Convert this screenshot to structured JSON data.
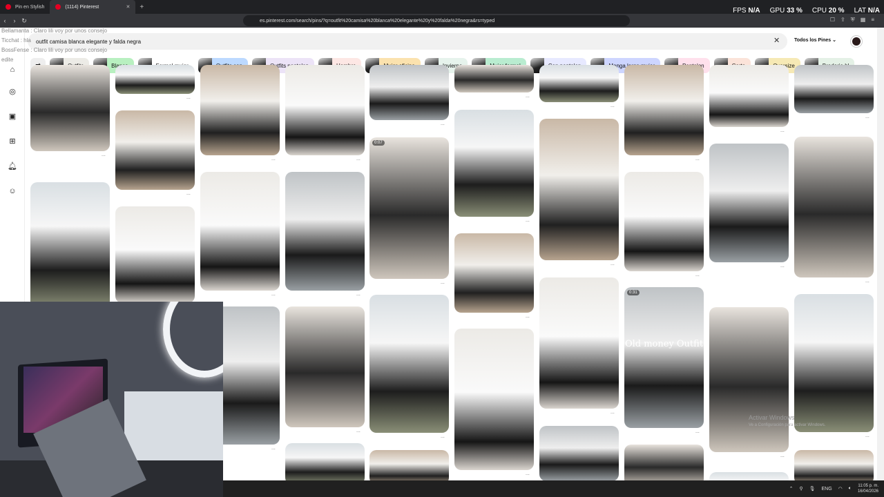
{
  "browser": {
    "tabs": [
      {
        "label": "Pin en Stylish",
        "active": false
      },
      {
        "label": "(1114) Pinterest",
        "active": true
      }
    ],
    "new_tab": "+",
    "url": "es.pinterest.com/search/pins/?q=outfit%20camisa%20blanca%20elegante%20y%20falda%20negra&rs=typed"
  },
  "hud": {
    "fps_label": "FPS",
    "fps_value": "N/A",
    "gpu_label": "GPU",
    "gpu_value": "33 %",
    "cpu_label": "CPU",
    "cpu_value": "20 %",
    "lat_label": "LAT",
    "lat_value": "N/A"
  },
  "chat": {
    "line1": "Bellamanta : Claro lili voy por unos consejo",
    "line2": "Ticchat : hla",
    "line3": "BossFense : Claro lili voy por unos consejo",
    "line4": "edite"
  },
  "search": {
    "query": "outfit camisa blanca elegante y falda negra",
    "filter_label": "Todos los Pines"
  },
  "chips": [
    {
      "label": "Outfits",
      "bg": "#ecebe6"
    },
    {
      "label": "Blanca",
      "bg": "#b8f0c0"
    },
    {
      "label": "Formal mujer",
      "bg": "#ffffff"
    },
    {
      "label": "Outfits con",
      "bg": "#bcd9ff"
    },
    {
      "label": "Outfits pantalon",
      "bg": "#ece3f7"
    },
    {
      "label": "Hombre",
      "bg": "#fde7e4"
    },
    {
      "label": "Mujer oficina",
      "bg": "#fbe2ae"
    },
    {
      "label": "Invierno",
      "bg": "#e6f3ec"
    },
    {
      "label": "Mujer formal",
      "bg": "#b9ecd0"
    },
    {
      "label": "Con pantalon",
      "bg": "#e7e9ff"
    },
    {
      "label": "Manga larga mujer",
      "bg": "#cdd5ff"
    },
    {
      "label": "Pantalon",
      "bg": "#ffe0ec"
    },
    {
      "label": "Corta",
      "bg": "#fbe3d9"
    },
    {
      "label": "Oversize",
      "bg": "#f6e9b5"
    },
    {
      "label": "Broderie bl",
      "bg": "#e4f1e6"
    }
  ],
  "pins": {
    "badge_video": "0:07",
    "badge_video2": "0:31",
    "overlay_text": "Old money Outfit",
    "more": "..."
  },
  "watermark": {
    "line1": "Activar Windows",
    "line2": "Ve a Configuración para activar Windows."
  },
  "taskbar": {
    "lang": "ENG",
    "time": "11:05 p. m.",
    "date": "16/04/2026"
  }
}
